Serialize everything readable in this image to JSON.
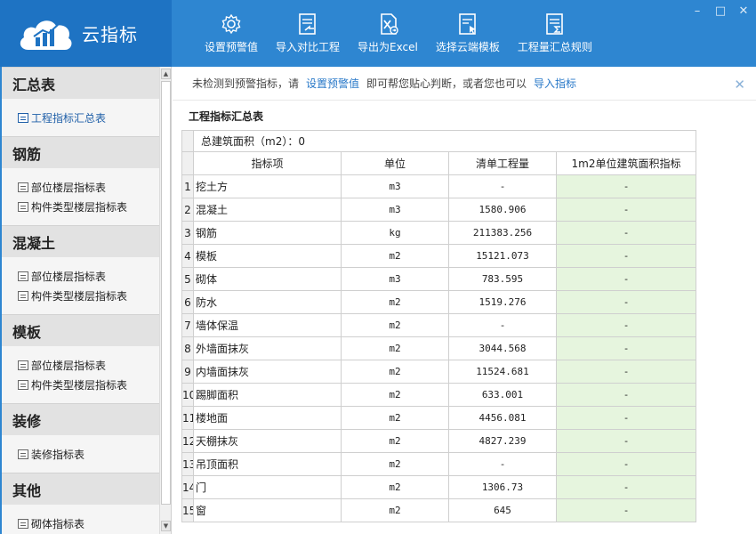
{
  "app": {
    "title": "云指标"
  },
  "toolbar": {
    "items": [
      {
        "label": "设置预警值",
        "icon": "gear-icon"
      },
      {
        "label": "导入对比工程",
        "icon": "import-document-icon"
      },
      {
        "label": "导出为Excel",
        "icon": "excel-export-icon"
      },
      {
        "label": "选择云端模板",
        "icon": "cloud-template-icon"
      },
      {
        "label": "工程量汇总规则",
        "icon": "sum-rules-icon"
      }
    ]
  },
  "window_controls": {
    "min": "–",
    "max": "□",
    "close": "✕"
  },
  "sidebar": {
    "groups": [
      {
        "title": "汇总表",
        "items": [
          {
            "label": "工程指标汇总表",
            "active": true
          }
        ]
      },
      {
        "title": "钢筋",
        "items": [
          {
            "label": "部位楼层指标表"
          },
          {
            "label": "构件类型楼层指标表"
          }
        ]
      },
      {
        "title": "混凝土",
        "items": [
          {
            "label": "部位楼层指标表"
          },
          {
            "label": "构件类型楼层指标表"
          }
        ]
      },
      {
        "title": "模板",
        "items": [
          {
            "label": "部位楼层指标表"
          },
          {
            "label": "构件类型楼层指标表"
          }
        ]
      },
      {
        "title": "装修",
        "items": [
          {
            "label": "装修指标表"
          }
        ]
      },
      {
        "title": "其他",
        "items": [
          {
            "label": "砌体指标表"
          }
        ]
      }
    ]
  },
  "notice": {
    "text1": "未检测到预警指标，请",
    "link1": "设置预警值",
    "text2": "即可帮您贴心判断，或者您也可以",
    "link2": "导入指标",
    "close": "✕"
  },
  "main": {
    "section_title": "工程指标汇总表",
    "area_label": "总建筑面积（m2）：0",
    "columns": [
      "指标项",
      "单位",
      "清单工程量",
      "1m2单位建筑面积指标"
    ],
    "rows": [
      {
        "no": "1",
        "name": "挖土方",
        "unit": "m3",
        "qty": "-",
        "index": "-"
      },
      {
        "no": "2",
        "name": "混凝土",
        "unit": "m3",
        "qty": "1580.906",
        "index": "-"
      },
      {
        "no": "3",
        "name": "钢筋",
        "unit": "kg",
        "qty": "211383.256",
        "index": "-"
      },
      {
        "no": "4",
        "name": "模板",
        "unit": "m2",
        "qty": "15121.073",
        "index": "-"
      },
      {
        "no": "5",
        "name": "砌体",
        "unit": "m3",
        "qty": "783.595",
        "index": "-"
      },
      {
        "no": "6",
        "name": "防水",
        "unit": "m2",
        "qty": "1519.276",
        "index": "-"
      },
      {
        "no": "7",
        "name": "墙体保温",
        "unit": "m2",
        "qty": "-",
        "index": "-"
      },
      {
        "no": "8",
        "name": "外墙面抹灰",
        "unit": "m2",
        "qty": "3044.568",
        "index": "-"
      },
      {
        "no": "9",
        "name": "内墙面抹灰",
        "unit": "m2",
        "qty": "11524.681",
        "index": "-"
      },
      {
        "no": "10",
        "name": "踢脚面积",
        "unit": "m2",
        "qty": "633.001",
        "index": "-"
      },
      {
        "no": "11",
        "name": "楼地面",
        "unit": "m2",
        "qty": "4456.081",
        "index": "-"
      },
      {
        "no": "12",
        "name": "天棚抹灰",
        "unit": "m2",
        "qty": "4827.239",
        "index": "-"
      },
      {
        "no": "13",
        "name": "吊顶面积",
        "unit": "m2",
        "qty": "-",
        "index": "-"
      },
      {
        "no": "14",
        "name": "门",
        "unit": "m2",
        "qty": "1306.73",
        "index": "-"
      },
      {
        "no": "15",
        "name": "窗",
        "unit": "m2",
        "qty": "645",
        "index": "-"
      }
    ]
  },
  "colors": {
    "header_blue": "#2e86d1",
    "brand_blue": "#1e73c3",
    "link_blue": "#2878c8",
    "index_cell_green": "#e6f5de"
  }
}
